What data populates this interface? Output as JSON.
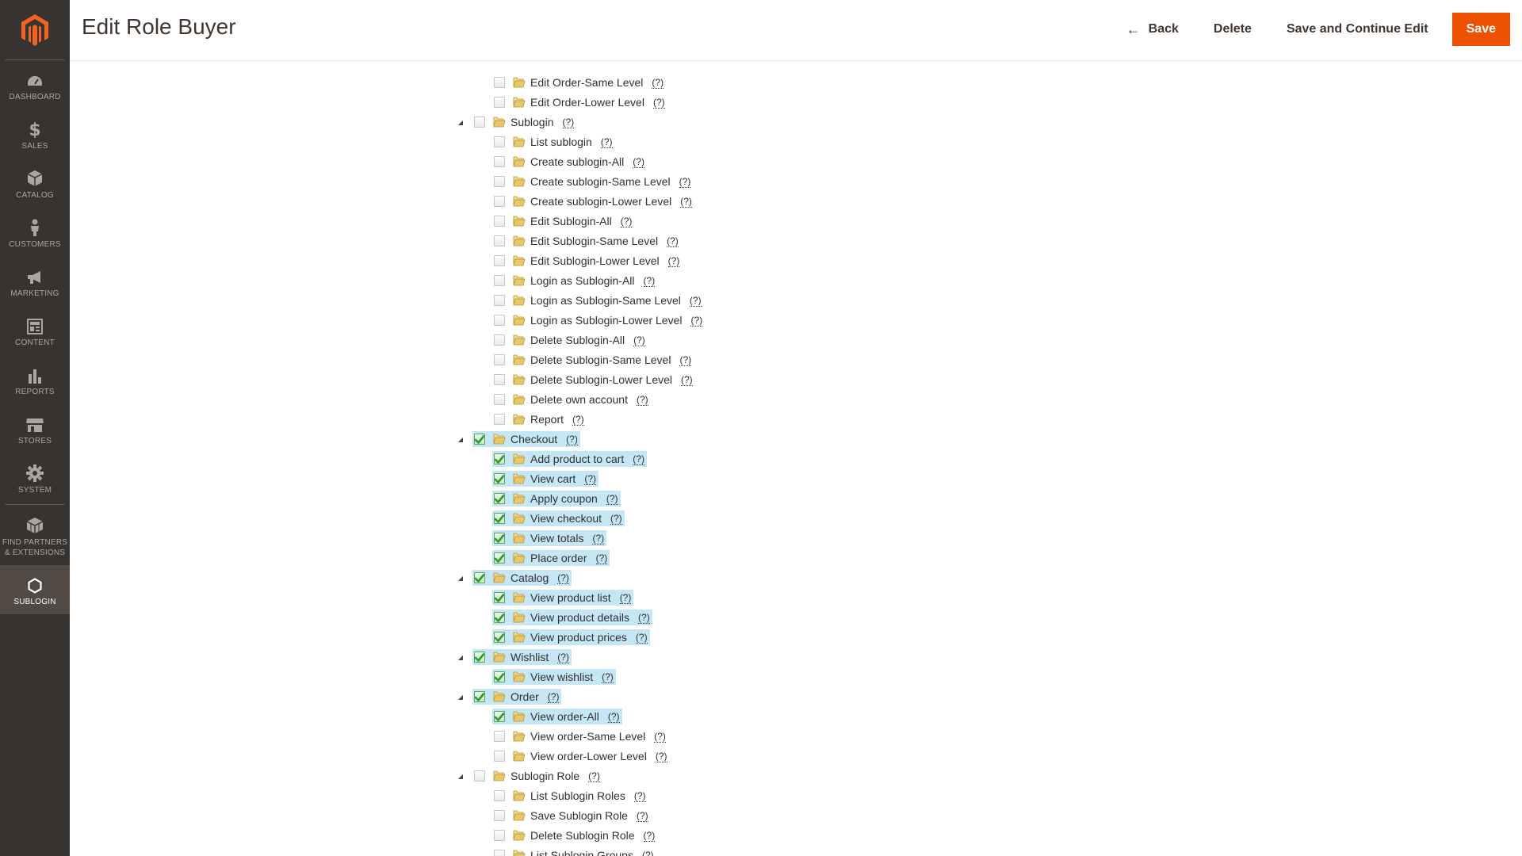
{
  "header": {
    "title": "Edit Role Buyer",
    "back_label": "Back",
    "delete_label": "Delete",
    "save_continue_label": "Save and Continue Edit",
    "save_label": "Save"
  },
  "sidebar": {
    "items": [
      {
        "label": "Dashboard",
        "icon": "dashboard-icon",
        "active": false
      },
      {
        "label": "Sales",
        "icon": "dollar-icon",
        "active": false
      },
      {
        "label": "Catalog",
        "icon": "box-icon",
        "active": false
      },
      {
        "label": "Customers",
        "icon": "person-icon",
        "active": false
      },
      {
        "label": "Marketing",
        "icon": "megaphone-icon",
        "active": false
      },
      {
        "label": "Content",
        "icon": "content-icon",
        "active": false
      },
      {
        "label": "Reports",
        "icon": "bar-chart-icon",
        "active": false
      },
      {
        "label": "Stores",
        "icon": "store-icon",
        "active": false
      },
      {
        "label": "System",
        "icon": "gear-icon",
        "active": false
      },
      {
        "label": "Find Partners & Extensions",
        "icon": "boxes-icon",
        "active": false
      },
      {
        "label": "Sublogin",
        "icon": "hexagon-icon",
        "active": true
      }
    ]
  },
  "tree": {
    "help_text": "(?)",
    "nodes": [
      {
        "label": "Edit Order-Same Level",
        "level": 2,
        "checked": false,
        "toggle": false
      },
      {
        "label": "Edit Order-Lower Level",
        "level": 2,
        "checked": false,
        "toggle": false
      },
      {
        "label": "Sublogin",
        "level": 1,
        "checked": false,
        "toggle": true
      },
      {
        "label": "List sublogin",
        "level": 2,
        "checked": false,
        "toggle": false
      },
      {
        "label": "Create sublogin-All",
        "level": 2,
        "checked": false,
        "toggle": false
      },
      {
        "label": "Create sublogin-Same Level",
        "level": 2,
        "checked": false,
        "toggle": false
      },
      {
        "label": "Create sublogin-Lower Level",
        "level": 2,
        "checked": false,
        "toggle": false
      },
      {
        "label": "Edit Sublogin-All",
        "level": 2,
        "checked": false,
        "toggle": false
      },
      {
        "label": "Edit Sublogin-Same Level",
        "level": 2,
        "checked": false,
        "toggle": false
      },
      {
        "label": "Edit Sublogin-Lower Level",
        "level": 2,
        "checked": false,
        "toggle": false
      },
      {
        "label": "Login as Sublogin-All",
        "level": 2,
        "checked": false,
        "toggle": false
      },
      {
        "label": "Login as Sublogin-Same Level",
        "level": 2,
        "checked": false,
        "toggle": false
      },
      {
        "label": "Login as Sublogin-Lower Level",
        "level": 2,
        "checked": false,
        "toggle": false
      },
      {
        "label": "Delete Sublogin-All",
        "level": 2,
        "checked": false,
        "toggle": false
      },
      {
        "label": "Delete Sublogin-Same Level",
        "level": 2,
        "checked": false,
        "toggle": false
      },
      {
        "label": "Delete Sublogin-Lower Level",
        "level": 2,
        "checked": false,
        "toggle": false
      },
      {
        "label": "Delete own account",
        "level": 2,
        "checked": false,
        "toggle": false
      },
      {
        "label": "Report",
        "level": 2,
        "checked": false,
        "toggle": false
      },
      {
        "label": "Checkout",
        "level": 1,
        "checked": true,
        "toggle": true
      },
      {
        "label": "Add product to cart",
        "level": 2,
        "checked": true,
        "toggle": false
      },
      {
        "label": "View cart",
        "level": 2,
        "checked": true,
        "toggle": false
      },
      {
        "label": "Apply coupon",
        "level": 2,
        "checked": true,
        "toggle": false
      },
      {
        "label": "View checkout",
        "level": 2,
        "checked": true,
        "toggle": false
      },
      {
        "label": "View totals",
        "level": 2,
        "checked": true,
        "toggle": false
      },
      {
        "label": "Place order",
        "level": 2,
        "checked": true,
        "toggle": false
      },
      {
        "label": "Catalog",
        "level": 1,
        "checked": true,
        "toggle": true
      },
      {
        "label": "View product list",
        "level": 2,
        "checked": true,
        "toggle": false
      },
      {
        "label": "View product details",
        "level": 2,
        "checked": true,
        "toggle": false
      },
      {
        "label": "View product prices",
        "level": 2,
        "checked": true,
        "toggle": false
      },
      {
        "label": "Wishlist",
        "level": 1,
        "checked": true,
        "toggle": true
      },
      {
        "label": "View wishlist",
        "level": 2,
        "checked": true,
        "toggle": false
      },
      {
        "label": "Order",
        "level": 1,
        "checked": true,
        "toggle": true
      },
      {
        "label": "View order-All",
        "level": 2,
        "checked": true,
        "toggle": false
      },
      {
        "label": "View order-Same Level",
        "level": 2,
        "checked": false,
        "toggle": false
      },
      {
        "label": "View order-Lower Level",
        "level": 2,
        "checked": false,
        "toggle": false
      },
      {
        "label": "Sublogin Role",
        "level": 1,
        "checked": false,
        "toggle": true
      },
      {
        "label": "List Sublogin Roles",
        "level": 2,
        "checked": false,
        "toggle": false
      },
      {
        "label": "Save Sublogin Role",
        "level": 2,
        "checked": false,
        "toggle": false
      },
      {
        "label": "Delete Sublogin Role",
        "level": 2,
        "checked": false,
        "toggle": false
      },
      {
        "label": "List Sublogin Groups",
        "level": 2,
        "checked": false,
        "toggle": false
      }
    ]
  },
  "colors": {
    "accent": "#eb5202",
    "sidebar_bg": "#373330",
    "selected_bg": "#c5e6f5"
  }
}
